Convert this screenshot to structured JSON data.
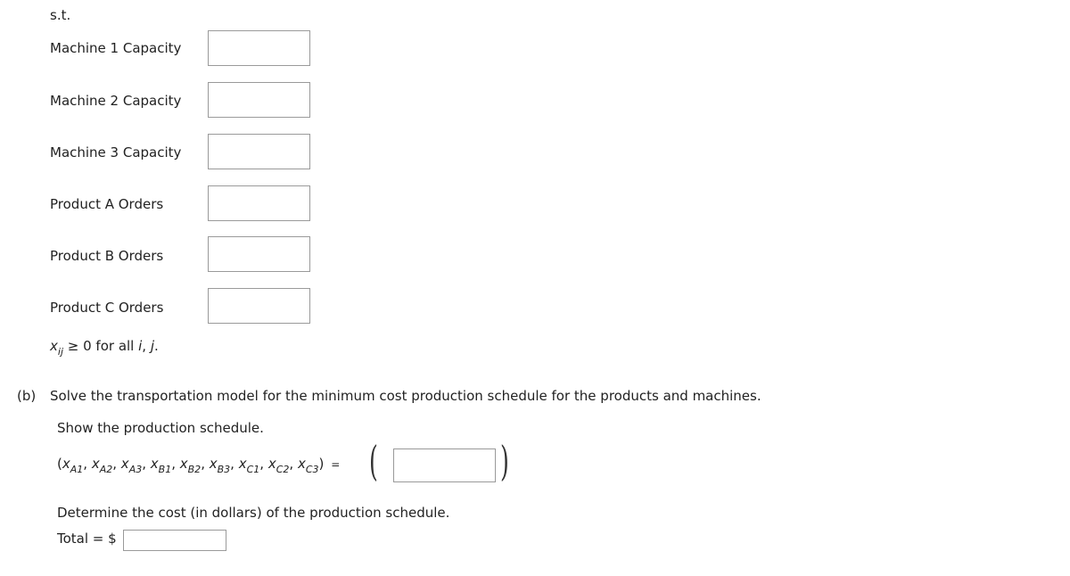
{
  "st_label": "s.t.",
  "constraints": [
    {
      "label": "Machine 1 Capacity",
      "value": ""
    },
    {
      "label": "Machine 2 Capacity",
      "value": ""
    },
    {
      "label": "Machine 3 Capacity",
      "value": ""
    },
    {
      "label": "Product A Orders",
      "value": ""
    },
    {
      "label": "Product B Orders",
      "value": ""
    },
    {
      "label": "Product C Orders",
      "value": ""
    }
  ],
  "nonneg": {
    "var": "x",
    "sub": "ij",
    "text": " ≥ 0 for all ",
    "i": "i",
    "comma": ", ",
    "j": "j",
    "period": "."
  },
  "part_b": {
    "label": "(b)",
    "question": "Solve the transportation model for the minimum cost production schedule for the products and machines.",
    "show_text": "Show the production schedule.",
    "tuple_vars": [
      {
        "v": "x",
        "s": "A1"
      },
      {
        "v": "x",
        "s": "A2"
      },
      {
        "v": "x",
        "s": "A3"
      },
      {
        "v": "x",
        "s": "B1"
      },
      {
        "v": "x",
        "s": "B2"
      },
      {
        "v": "x",
        "s": "B3"
      },
      {
        "v": "x",
        "s": "C1"
      },
      {
        "v": "x",
        "s": "C2"
      },
      {
        "v": "x",
        "s": "C3"
      }
    ],
    "equals": "=",
    "schedule_value": "",
    "cost_text": "Determine the cost (in dollars) of the production schedule.",
    "total_label": "Total = $",
    "total_value": ""
  }
}
